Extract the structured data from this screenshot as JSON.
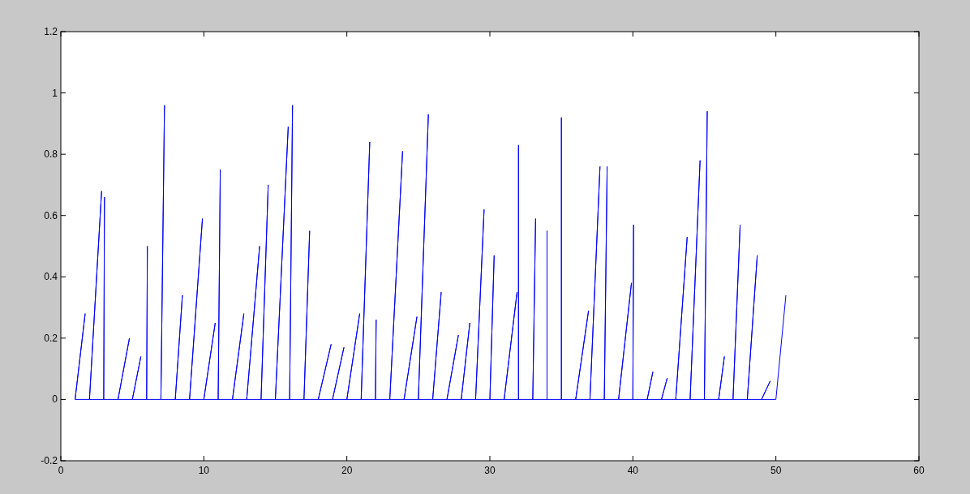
{
  "figure": {
    "chart_data": {
      "type": "line",
      "xlim": [
        0,
        60
      ],
      "ylim": [
        -0.2,
        1.2
      ],
      "xticks": [
        0,
        10,
        20,
        30,
        40,
        50,
        60
      ],
      "yticks": [
        -0.2,
        0,
        0.2,
        0.4,
        0.6,
        0.8,
        1,
        1.2
      ],
      "x": [
        1,
        1.7,
        1,
        2,
        2.85,
        2,
        3,
        3.05,
        3,
        4,
        4.8,
        4,
        5,
        5.6,
        5,
        6,
        6.05,
        6,
        7,
        7.25,
        7,
        8,
        8.5,
        8,
        9,
        9.9,
        9,
        10,
        10.8,
        10,
        11,
        11.15,
        11,
        12,
        12.8,
        12,
        13,
        13.9,
        13,
        14,
        14.5,
        14,
        15,
        15.9,
        15,
        16,
        16.2,
        16,
        17,
        17.4,
        17,
        18,
        18.9,
        18,
        19,
        19.8,
        19,
        20,
        20.9,
        20,
        21,
        21.6,
        21,
        22,
        22.05,
        22,
        23,
        23.9,
        23,
        24,
        24.9,
        24,
        25,
        25.7,
        25,
        26,
        26.6,
        26,
        27,
        27.8,
        27,
        28,
        28.6,
        28,
        29,
        29.6,
        29,
        30,
        30.3,
        30,
        31,
        31.9,
        31,
        32,
        32,
        32,
        33,
        33.2,
        33,
        34,
        34,
        34,
        35,
        35,
        35,
        36,
        36.9,
        36,
        37,
        37.7,
        37,
        38,
        38.2,
        38,
        39,
        39.9,
        39,
        40,
        40.05,
        40,
        41,
        41.4,
        41,
        42,
        42.4,
        42,
        43,
        43.8,
        43,
        44,
        44.7,
        44,
        45,
        45.2,
        45,
        46,
        46.4,
        46,
        47,
        47.5,
        47,
        48,
        48.7,
        48,
        49,
        49.6,
        49,
        50,
        50.7
      ],
      "series": [
        {
          "color": "#0000ff",
          "values": [
            0,
            0.28,
            0,
            0,
            0.68,
            0,
            0,
            0.66,
            0,
            0,
            0.2,
            0,
            0,
            0.14,
            0,
            0,
            0.5,
            0,
            0,
            0.96,
            0,
            0,
            0.34,
            0,
            0,
            0.59,
            0,
            0,
            0.25,
            0,
            0,
            0.75,
            0,
            0,
            0.28,
            0,
            0,
            0.5,
            0,
            0,
            0.7,
            0,
            0,
            0.89,
            0,
            0,
            0.96,
            0,
            0,
            0.55,
            0,
            0,
            0.18,
            0,
            0,
            0.17,
            0,
            0,
            0.28,
            0,
            0,
            0.84,
            0,
            0,
            0.26,
            0,
            0,
            0.81,
            0,
            0,
            0.27,
            0,
            0,
            0.93,
            0,
            0,
            0.35,
            0,
            0,
            0.21,
            0,
            0,
            0.25,
            0,
            0,
            0.62,
            0,
            0,
            0.47,
            0,
            0,
            0.35,
            0,
            0,
            0.83,
            0,
            0,
            0.59,
            0,
            0,
            0.55,
            0,
            0,
            0.92,
            0,
            0,
            0.29,
            0,
            0,
            0.76,
            0,
            0,
            0.76,
            0,
            0,
            0.38,
            0,
            0,
            0.57,
            0,
            0,
            0.09,
            0,
            0,
            0.07,
            0,
            0,
            0.53,
            0,
            0,
            0.78,
            0,
            0,
            0.94,
            0,
            0,
            0.14,
            0,
            0,
            0.57,
            0,
            0,
            0.47,
            0,
            0,
            0.06,
            0,
            0,
            0.34
          ]
        }
      ]
    }
  }
}
